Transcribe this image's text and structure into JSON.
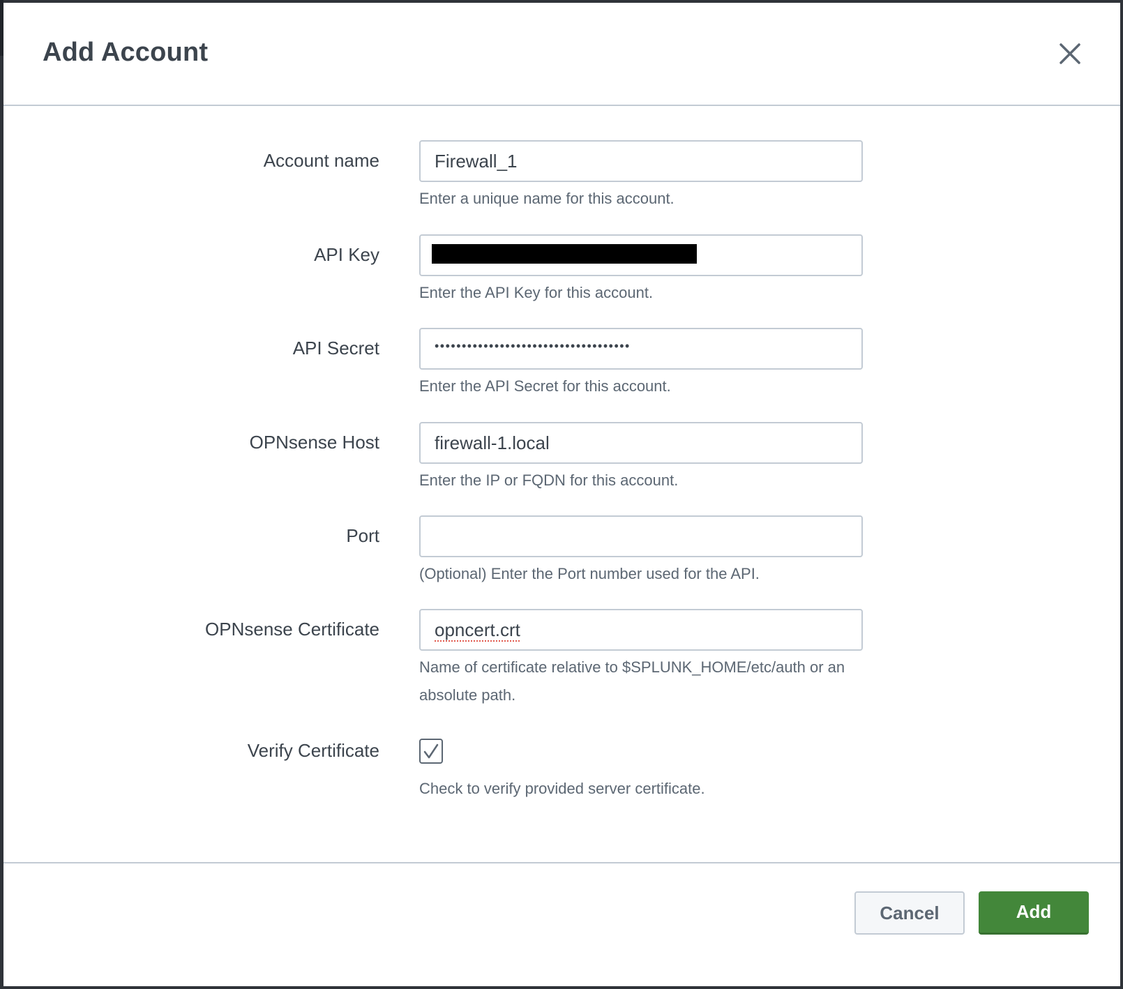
{
  "modal": {
    "title": "Add Account",
    "close_icon": "close-icon"
  },
  "fields": {
    "account_name": {
      "label": "Account name",
      "value": "Firewall_1",
      "help": "Enter a unique name for this account."
    },
    "api_key": {
      "label": "API Key",
      "value": "[redacted]",
      "help": "Enter the API Key for this account."
    },
    "api_secret": {
      "label": "API Secret",
      "masked_value": "••••••••••••••••••••••••••••••••••••",
      "help": "Enter the API Secret for this account."
    },
    "host": {
      "label": "OPNsense Host",
      "value": "firewall-1.local",
      "help": "Enter the IP or FQDN for this account."
    },
    "port": {
      "label": "Port",
      "value": "",
      "help": "(Optional) Enter the Port number used for the API."
    },
    "certificate": {
      "label": "OPNsense Certificate",
      "value": "opncert.crt",
      "help": "Name of certificate relative to $SPLUNK_HOME/etc/auth or an absolute path."
    },
    "verify_certificate": {
      "label": "Verify Certificate",
      "checked": true,
      "help": "Check to verify provided server certificate."
    }
  },
  "footer": {
    "cancel_label": "Cancel",
    "add_label": "Add"
  },
  "colors": {
    "primary": "#43873a",
    "text": "#3c444d",
    "muted": "#5c6773",
    "border": "#c3cbd4"
  }
}
